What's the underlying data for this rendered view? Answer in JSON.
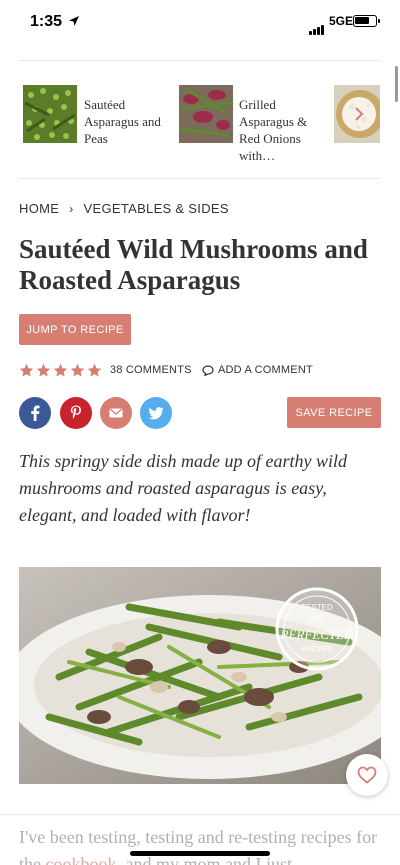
{
  "status_bar": {
    "time": "1:35",
    "network": "5GE"
  },
  "related": [
    {
      "title": "Sautéed Asparagus and Peas"
    },
    {
      "title": "Grilled Asparagus & Red Onions with…"
    }
  ],
  "breadcrumb": {
    "home": "HOME",
    "category": "VEGETABLES & SIDES"
  },
  "recipe": {
    "title": "Sautéed Wild Mushrooms and Roasted Asparagus",
    "jump_label": "JUMP TO RECIPE",
    "rating": 5,
    "comments_label": "38 COMMENTS",
    "add_comment_label": "ADD A COMMENT",
    "save_label": "SAVE RECIPE",
    "intro": "This springy side dish made up of earthy wild mushrooms and roasted asparagus is easy, elegant, and loaded with flavor!",
    "badge": {
      "line1": "TESTED",
      "line2": "AND",
      "line3": "PERFECTED",
      "line4": "RECIPES"
    },
    "body_start": "I've been testing, testing and re-testing recipes for the ",
    "body_link": "cookbook",
    "body_end": ", and my mom and I just"
  },
  "social": {
    "icons": [
      "facebook-icon",
      "pinterest-icon",
      "email-icon",
      "twitter-icon"
    ]
  },
  "colors": {
    "accent": "#d57e71",
    "facebook": "#3b5998",
    "pinterest": "#c8232c",
    "email": "#d57e71",
    "twitter": "#55acee"
  }
}
